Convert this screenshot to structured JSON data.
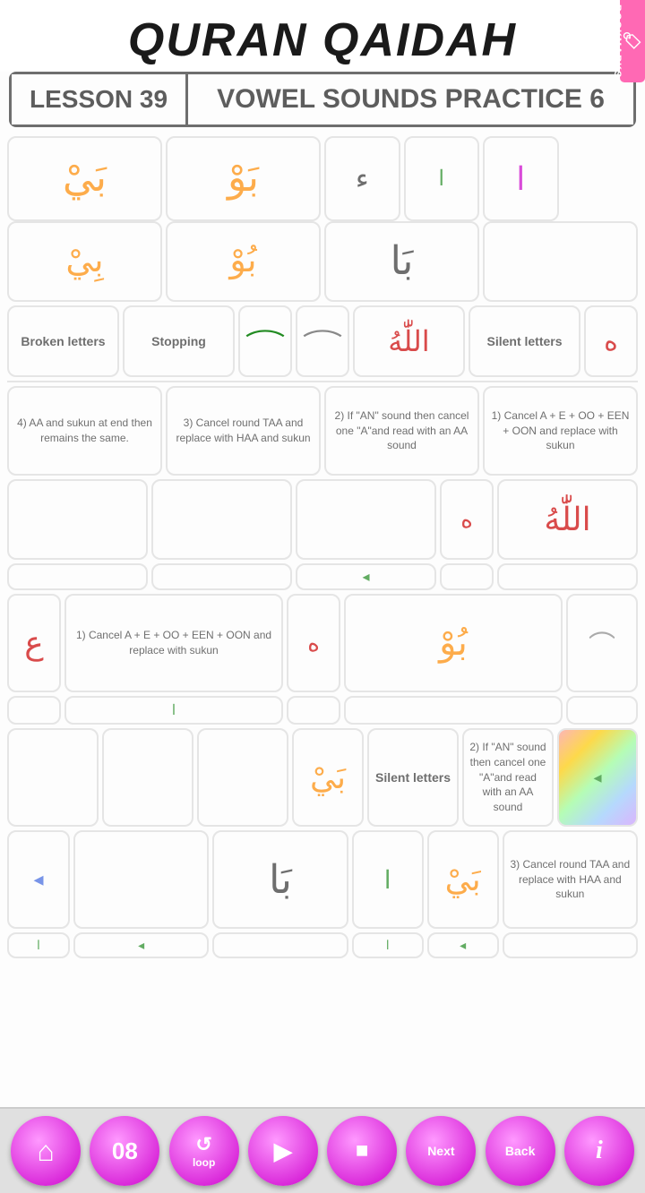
{
  "header": {
    "title": "QURAN QAIDAH",
    "bookmark_label": "BOOKMARKS"
  },
  "lesson": {
    "number_label": "LESSON 39",
    "title_label": "VOWEL SOUNDS PRACTICE 6"
  },
  "row1": {
    "cells": [
      {
        "text": "بَيْ",
        "color": "orange-teal",
        "colspan": 2
      },
      {
        "text": "بَوْ",
        "color": "orange-teal",
        "colspan": 2
      },
      {
        "text": "ء",
        "color": "black"
      },
      {
        "text": "",
        "color": "black"
      },
      {
        "text": "ا",
        "color": "magenta"
      },
      {
        "text": "بِيْ",
        "color": "orange-purple"
      },
      {
        "text": "بُوْ",
        "color": "orange-teal"
      },
      {
        "text": "بَا",
        "color": "black"
      }
    ]
  },
  "row1_sub": {
    "cells": [
      {
        "text": ""
      },
      {
        "text": ""
      },
      {
        "text": "ا",
        "color": "green"
      },
      {
        "text": ""
      },
      {
        "text": ""
      },
      {
        "text": ""
      },
      {
        "text": ""
      },
      {
        "text": ""
      }
    ]
  },
  "row2_labels": {
    "cells": [
      {
        "text": "Broken letters",
        "colspan": 1
      },
      {
        "text": "Stopping",
        "colspan": 1
      },
      {
        "symbol": "~",
        "color": "green"
      },
      {
        "symbol": "~",
        "color": "gray"
      },
      {
        "text": "اللّٰهُ",
        "color": "red",
        "arabic": true
      },
      {
        "text": "Silent letters",
        "colspan": 1
      },
      {
        "symbol": "ﻪ",
        "color": "red"
      }
    ]
  },
  "row3_rules": {
    "cells": [
      {
        "text": "4) AA and sukun at end then remains the same.",
        "colspan": 1
      },
      {
        "text": "3) Cancel round TAA and replace with HAA and sukun",
        "colspan": 1
      },
      {
        "text": "2) If \"AN\" sound then cancel one \"A\"and read with an AA sound",
        "colspan": 1
      },
      {
        "text": "1) Cancel A + E + OO + EEN + OON and replace with sukun",
        "colspan": 1
      }
    ]
  },
  "row4": {
    "cells": [
      {
        "text": "",
        "colspan": 3
      },
      {
        "text": "ﻪ",
        "color": "red"
      },
      {
        "text": "اللّٰهُ",
        "color": "red",
        "arabic": true
      }
    ]
  },
  "row5": {
    "cells": [
      {
        "symbol": "ع",
        "color": "red"
      },
      {
        "text": "1) Cancel A + E + OO + EEN + OON and replace with sukun"
      },
      {
        "text": "ﻪ",
        "color": "red"
      },
      {
        "text": "بُوْ",
        "color": "orange-teal"
      },
      {
        "symbol": "~",
        "color": "gray"
      }
    ]
  },
  "row6": {
    "cells": [
      {
        "text": "",
        "colspan": 3
      },
      {
        "text": "بَيْ",
        "color": "orange-purple"
      },
      {
        "text": "Silent letters"
      },
      {
        "text": "2) If \"AN\" sound then cancel one \"A\"and read with an AA sound"
      },
      {
        "text": "rainbow"
      }
    ]
  },
  "row7": {
    "cells": [
      {
        "symbol": "leaf",
        "color": "blue"
      },
      {
        "text": ""
      },
      {
        "text": "بَا",
        "color": "black"
      },
      {
        "text": "ا",
        "color": "green"
      },
      {
        "text": "بَيْ",
        "color": "orange-purple"
      },
      {
        "text": "3) Cancel round TAA and replace with HAA and sukun"
      }
    ]
  },
  "bottom_nav": {
    "home_label": "⌂",
    "num_label": "08",
    "loop_label": "loop",
    "play_label": "▶",
    "stop_label": "■",
    "next_label": "Next",
    "back_label": "Back",
    "info_label": "i"
  }
}
